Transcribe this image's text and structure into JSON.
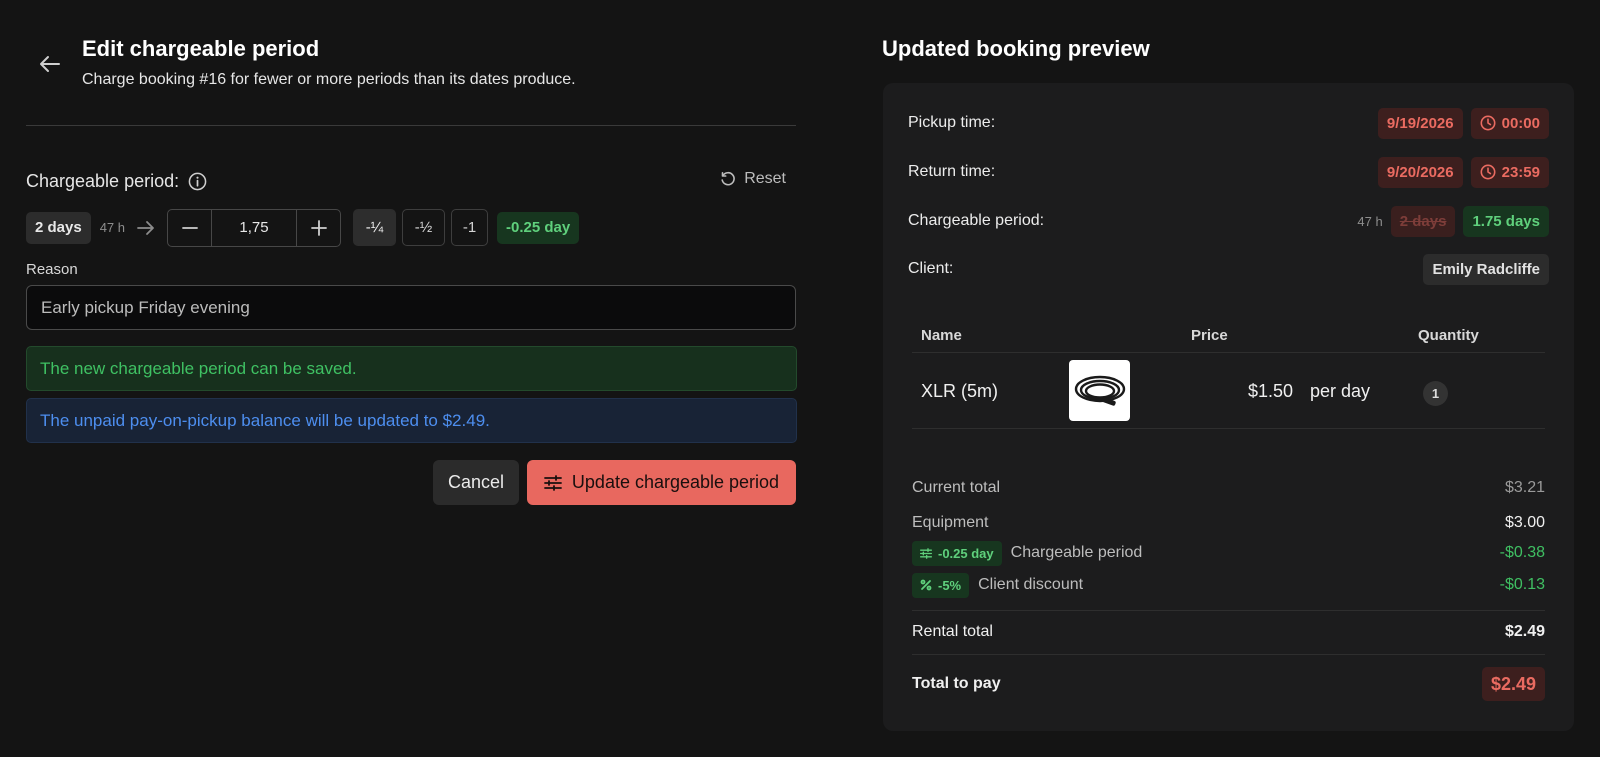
{
  "form": {
    "title": "Edit chargeable period",
    "subtitle": "Charge booking #16 for fewer or more periods than its dates produce.",
    "period_label": "Chargeable period:",
    "reset_label": "Reset",
    "original_days": "2 days",
    "hours": "47 h",
    "stepper_value": "1,75",
    "fraction_buttons": [
      "-¼",
      "-½",
      "-1"
    ],
    "delta_badge": "-0.25 day",
    "reason_label": "Reason",
    "reason_value": "Early pickup Friday evening",
    "alert_success": "The new chargeable period can be saved.",
    "alert_info": "The unpaid pay-on-pickup balance will be updated to $2.49.",
    "cancel_label": "Cancel",
    "update_label": "Update chargeable period"
  },
  "preview": {
    "title": "Updated booking preview",
    "pickup": {
      "label": "Pickup time:",
      "date": "9/19/2026",
      "time": "00:00"
    },
    "return": {
      "label": "Return time:",
      "date": "9/20/2026",
      "time": "23:59"
    },
    "chargeable": {
      "label": "Chargeable period:",
      "hours": "47 h",
      "old": "2 days",
      "new": "1.75 days"
    },
    "client": {
      "label": "Client:",
      "name": "Emily Radcliffe"
    },
    "table": {
      "headers": {
        "name": "Name",
        "price": "Price",
        "quantity": "Quantity"
      },
      "rows": [
        {
          "name": "XLR (5m)",
          "price": "$1.50",
          "unit": "per day",
          "qty": "1"
        }
      ]
    },
    "summary": {
      "current_total_label": "Current total",
      "current_total": "$3.21",
      "equipment_label": "Equipment",
      "equipment": "$3.00",
      "period_badge": "-0.25 day",
      "period_label": "Chargeable period",
      "period_value": "-$0.38",
      "discount_badge": "-5%",
      "discount_label": "Client discount",
      "discount_value": "-$0.13",
      "rental_total_label": "Rental total",
      "rental_total": "$2.49",
      "total_pay_label": "Total to pay",
      "total_pay": "$2.49"
    }
  },
  "colors": {
    "background": "#141414",
    "accent": "#e8685f",
    "success": "#3fc163",
    "info": "#4d8eef"
  }
}
